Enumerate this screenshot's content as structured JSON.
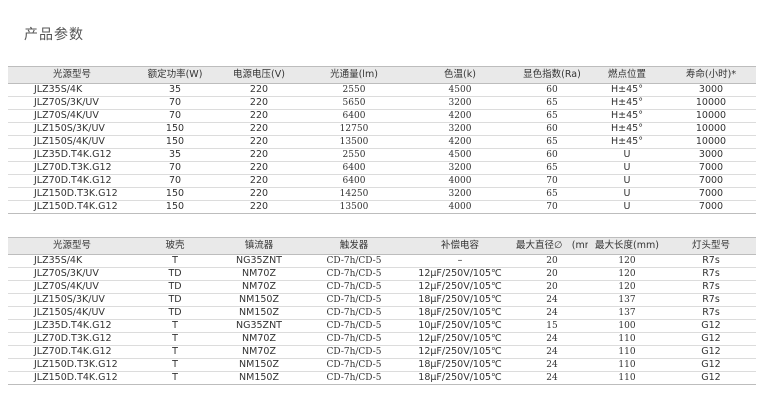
{
  "page": {
    "title": "产品参数"
  },
  "table1": {
    "headers": [
      "光源型号",
      "额定功率(W)",
      "电源电压(V)",
      "光通量(lm)",
      "色温(k)",
      "显色指数(Ra)",
      "燃点位置",
      "寿命(小时)*"
    ],
    "rows": [
      [
        "JLZ35S/4K",
        "35",
        "220",
        "2550",
        "4500",
        "60",
        "H±45°",
        "3000"
      ],
      [
        "JLZ70S/3K/UV",
        "70",
        "220",
        "5650",
        "3200",
        "65",
        "H±45°",
        "10000"
      ],
      [
        "JLZ70S/4K/UV",
        "70",
        "220",
        "6400",
        "4200",
        "65",
        "H±45°",
        "10000"
      ],
      [
        "JLZ150S/3K/UV",
        "150",
        "220",
        "12750",
        "3200",
        "60",
        "H±45°",
        "10000"
      ],
      [
        "JLZ150S/4K/UV",
        "150",
        "220",
        "13500",
        "4200",
        "65",
        "H±45°",
        "10000"
      ],
      [
        "JLZ35D.T4K.G12",
        "35",
        "220",
        "2550",
        "4500",
        "60",
        "U",
        "3000"
      ],
      [
        "JLZ70D.T3K.G12",
        "70",
        "220",
        "6400",
        "3200",
        "65",
        "U",
        "7000"
      ],
      [
        "JLZ70D.T4K.G12",
        "70",
        "220",
        "6400",
        "4000",
        "70",
        "U",
        "7000"
      ],
      [
        "JLZ150D.T3K.G12",
        "150",
        "220",
        "14250",
        "3200",
        "65",
        "U",
        "7000"
      ],
      [
        "JLZ150D.T4K.G12",
        "150",
        "220",
        "13500",
        "4000",
        "70",
        "U",
        "7000"
      ]
    ]
  },
  "table2": {
    "headers": [
      "光源型号",
      "玻壳",
      "镇流器",
      "触发器",
      "补偿电容",
      "最大直径∅　(mm)",
      "最大长度(mm)",
      "灯头型号"
    ],
    "rows": [
      [
        "JLZ35S/4K",
        "T",
        "NG35ZNT",
        "CD-7h/CD-5",
        "–",
        "20",
        "120",
        "R7s"
      ],
      [
        "JLZ70S/3K/UV",
        "TD",
        "NM70Z",
        "CD-7h/CD-5",
        "12μF/250V/105℃",
        "20",
        "120",
        "R7s"
      ],
      [
        "JLZ70S/4K/UV",
        "TD",
        "NM70Z",
        "CD-7h/CD-5",
        "12μF/250V/105℃",
        "20",
        "120",
        "R7s"
      ],
      [
        "JLZ150S/3K/UV",
        "TD",
        "NM150Z",
        "CD-7h/CD-5",
        "18μF/250V/105℃",
        "24",
        "137",
        "R7s"
      ],
      [
        "JLZ150S/4K/UV",
        "TD",
        "NM150Z",
        "CD-7h/CD-5",
        "18μF/250V/105℃",
        "24",
        "137",
        "R7s"
      ],
      [
        "JLZ35D.T4K.G12",
        "T",
        "NG35ZNT",
        "CD-7h/CD-5",
        "10μF/250V/105℃",
        "15",
        "100",
        "G12"
      ],
      [
        "JLZ70D.T3K.G12",
        "T",
        "NM70Z",
        "CD-7h/CD-5",
        "12μF/250V/105℃",
        "24",
        "110",
        "G12"
      ],
      [
        "JLZ70D.T4K.G12",
        "T",
        "NM70Z",
        "CD-7h/CD-5",
        "12μF/250V/105℃",
        "24",
        "110",
        "G12"
      ],
      [
        "JLZ150D.T3K.G12",
        "T",
        "NM150Z",
        "CD-7h/CD-5",
        "18μF/250V/105℃",
        "24",
        "110",
        "G12"
      ],
      [
        "JLZ150D.T4K.G12",
        "T",
        "NM150Z",
        "CD-7h/CD-5",
        "18μF/250V/105℃",
        "24",
        "110",
        "G12"
      ]
    ]
  }
}
